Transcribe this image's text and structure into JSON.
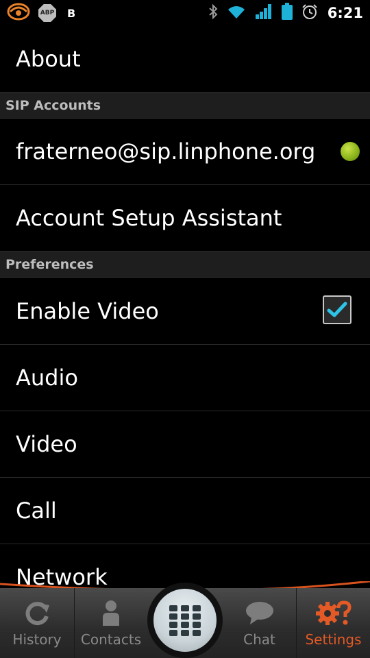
{
  "status_bar": {
    "time": "6:21",
    "abp_label": "ABP",
    "b_label": "B",
    "icons": [
      "linphone-icon",
      "abp-icon",
      "bluetooth-icon",
      "wifi-icon",
      "signal-icon",
      "battery-icon",
      "alarm-icon"
    ]
  },
  "settings": {
    "about_label": "About",
    "sip_section": "SIP Accounts",
    "account_label": "fraterneo@sip.linphone.org",
    "account_status_color": "#8db51b",
    "setup_label": "Account Setup Assistant",
    "preferences_section": "Preferences",
    "enable_video_label": "Enable Video",
    "enable_video_checked": true,
    "audio_label": "Audio",
    "video_label": "Video",
    "call_label": "Call",
    "network_label": "Network"
  },
  "tabbar": {
    "history": "History",
    "contacts": "Contacts",
    "chat": "Chat",
    "settings": "Settings",
    "active": "settings",
    "accent_color": "#e45a26"
  }
}
